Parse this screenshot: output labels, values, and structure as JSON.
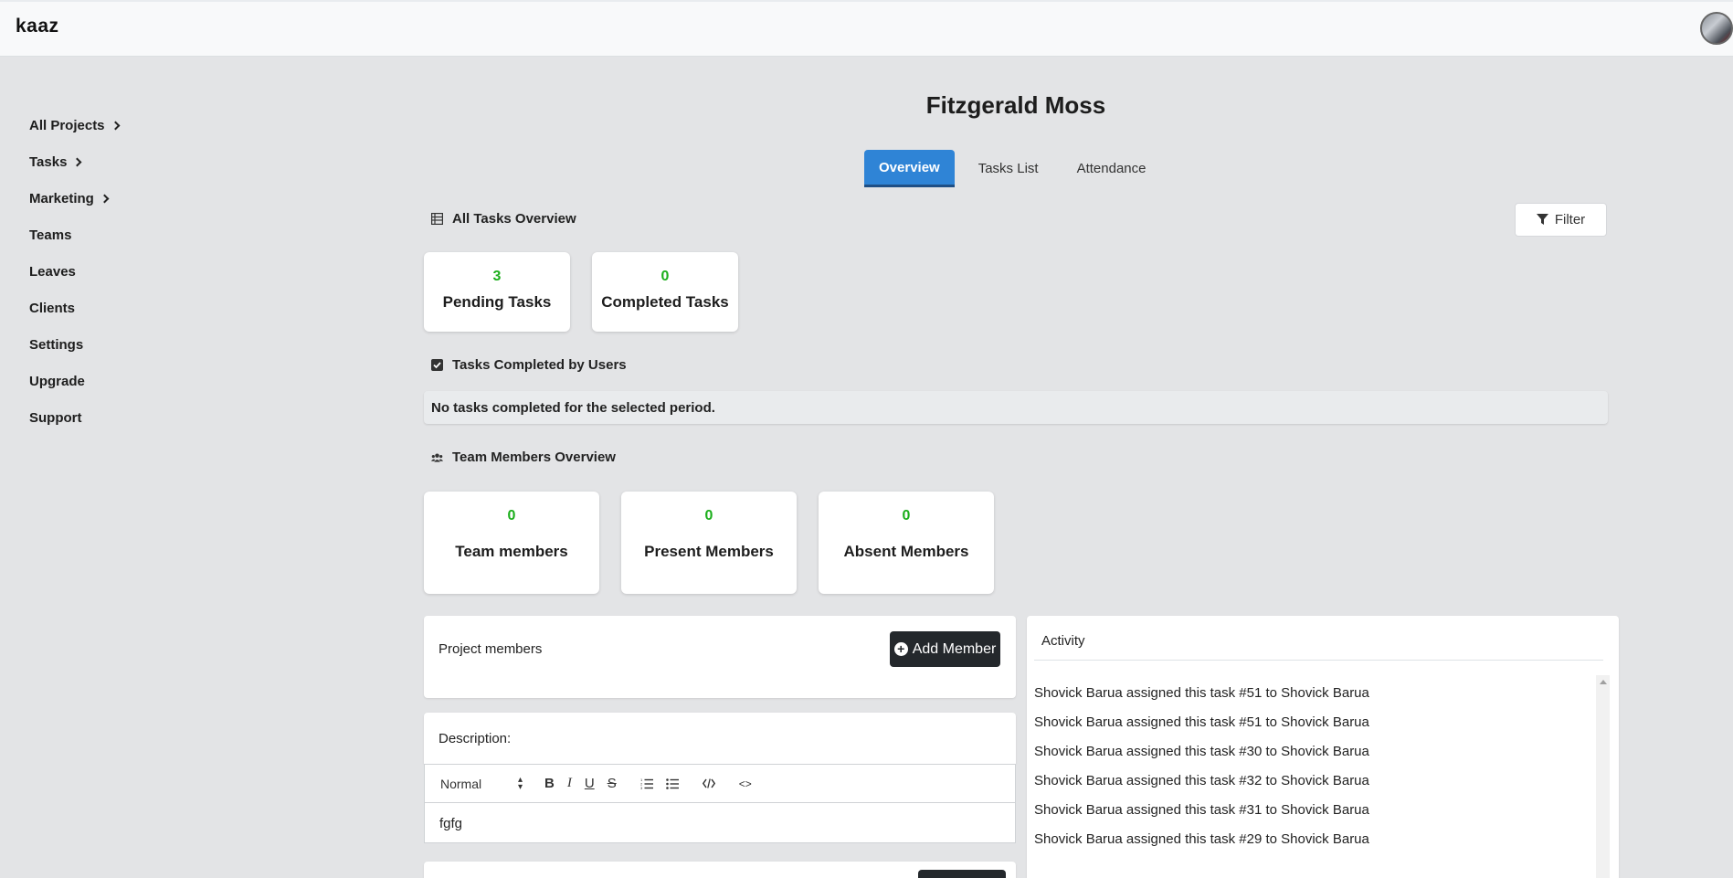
{
  "app": {
    "logo": "kaaz"
  },
  "sidebar": {
    "items": [
      {
        "label": "All Projects",
        "chevron": true
      },
      {
        "label": "Tasks",
        "chevron": true
      },
      {
        "label": "Marketing",
        "chevron": true
      },
      {
        "label": "Teams",
        "chevron": false
      },
      {
        "label": "Leaves",
        "chevron": false
      },
      {
        "label": "Clients",
        "chevron": false
      },
      {
        "label": "Settings",
        "chevron": false
      },
      {
        "label": "Upgrade",
        "chevron": false
      },
      {
        "label": "Support",
        "chevron": false
      }
    ]
  },
  "page": {
    "title": "Fitzgerald Moss"
  },
  "tabs": [
    {
      "label": "Overview",
      "active": true
    },
    {
      "label": "Tasks List",
      "active": false
    },
    {
      "label": "Attendance",
      "active": false
    }
  ],
  "tasks_overview": {
    "heading": "All Tasks Overview",
    "filter_label": "Filter",
    "cards": [
      {
        "value": "3",
        "label": "Pending Tasks"
      },
      {
        "value": "0",
        "label": "Completed Tasks"
      }
    ]
  },
  "completed_by_users": {
    "heading": "Tasks Completed by Users",
    "empty_message": "No tasks completed for the selected period."
  },
  "team_overview": {
    "heading": "Team Members Overview",
    "cards": [
      {
        "value": "0",
        "label": "Team members"
      },
      {
        "value": "0",
        "label": "Present Members"
      },
      {
        "value": "0",
        "label": "Absent Members"
      }
    ]
  },
  "project_members": {
    "title": "Project members",
    "add_label": "Add Member"
  },
  "description": {
    "title": "Description:",
    "format_select": "Normal",
    "toolbar": {
      "bold": "B",
      "italic": "I",
      "underline": "U",
      "strike": "S",
      "code": "<>"
    },
    "content": "fgfg"
  },
  "activity": {
    "title": "Activity",
    "items": [
      "Shovick Barua assigned this task #51 to Shovick Barua",
      "Shovick Barua assigned this task #51 to Shovick Barua",
      "Shovick Barua assigned this task #30 to Shovick Barua",
      "Shovick Barua assigned this task #32 to Shovick Barua",
      "Shovick Barua assigned this task #31 to Shovick Barua",
      "Shovick Barua assigned this task #29 to Shovick Barua"
    ]
  },
  "colors": {
    "accent": "#2f84d6",
    "count_green": "#1aae1a",
    "dark_button": "#24282c"
  }
}
